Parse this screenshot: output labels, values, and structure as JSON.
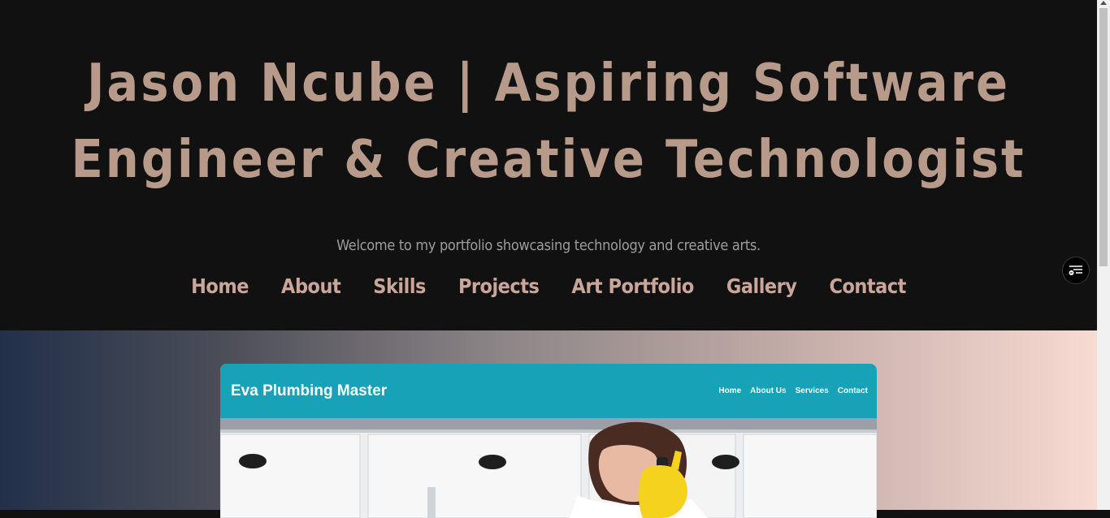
{
  "header": {
    "title": "Jason Ncube | Aspiring Software Engineer & Creative Technologist",
    "subtitle": "Welcome to my portfolio showcasing technology and creative arts."
  },
  "nav": {
    "items": [
      "Home",
      "About",
      "Skills",
      "Projects",
      "Art Portfolio",
      "Gallery",
      "Contact"
    ]
  },
  "fab": {
    "icon": "reader-menu-icon"
  },
  "project_card": {
    "title": "Eva Plumbing Master",
    "nav": [
      "Home",
      "About Us",
      "Services",
      "Contact"
    ],
    "image": "woman-on-phone-under-sink-photo"
  },
  "colors": {
    "background": "#121111",
    "title": "#b89a8a",
    "nav": "#c9a59a",
    "card_bar": "#17a2b8"
  }
}
